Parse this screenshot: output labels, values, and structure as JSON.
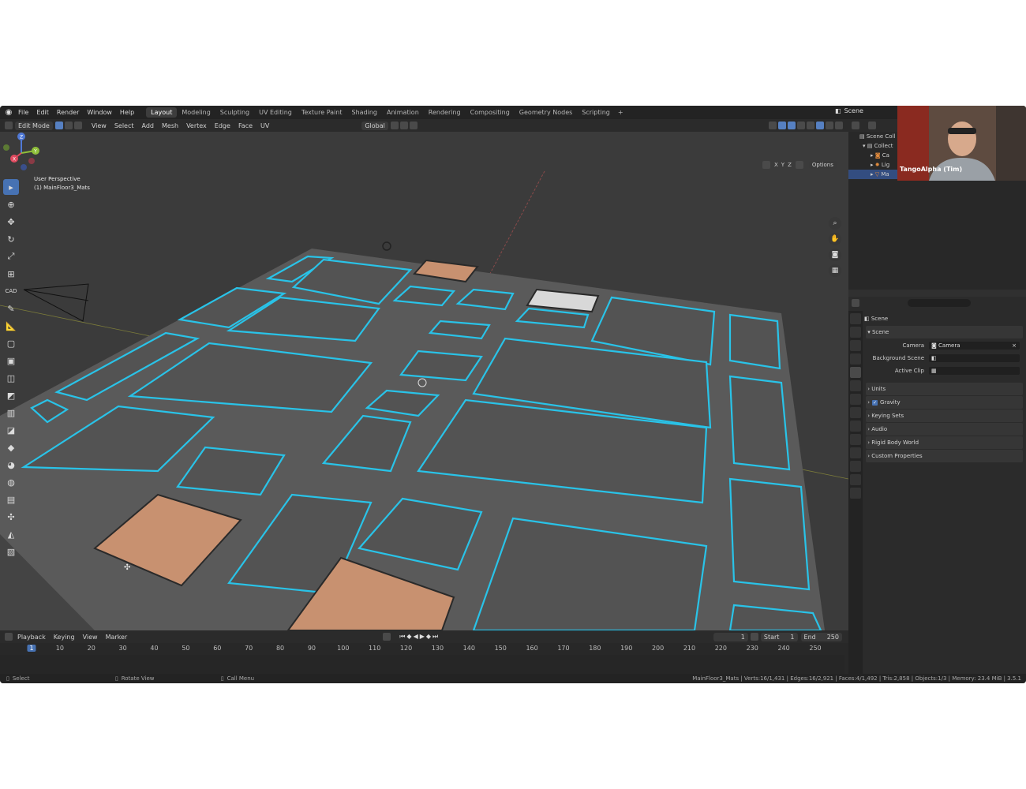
{
  "menubar": {
    "items": [
      "File",
      "Edit",
      "Render",
      "Window",
      "Help"
    ],
    "workspaces": [
      "Layout",
      "Modeling",
      "Sculpting",
      "UV Editing",
      "Texture Paint",
      "Shading",
      "Animation",
      "Rendering",
      "Compositing",
      "Geometry Nodes",
      "Scripting"
    ],
    "active_workspace": "Layout",
    "scene": "Scene"
  },
  "header": {
    "mode": "Edit Mode",
    "menus": [
      "View",
      "Select",
      "Add",
      "Mesh",
      "Vertex",
      "Edge",
      "Face",
      "UV"
    ],
    "orientation": "Global",
    "options": "Options",
    "axes": [
      "X",
      "Y",
      "Z"
    ]
  },
  "viewport": {
    "view_name": "User Perspective",
    "object_name": "(1) MainFloor3_Mats",
    "gizmo_axes": {
      "z": "Z",
      "x": "X",
      "y": "Y"
    }
  },
  "toolbar": {
    "cad_label": "CAD"
  },
  "timeline": {
    "menus": [
      "Playback",
      "Keying",
      "View",
      "Marker"
    ],
    "current_frame": "1",
    "start_label": "Start",
    "start_value": "1",
    "end_label": "End",
    "end_value": "250",
    "ticks": [
      "1",
      "10",
      "20",
      "30",
      "40",
      "50",
      "60",
      "70",
      "80",
      "90",
      "100",
      "110",
      "120",
      "130",
      "140",
      "150",
      "160",
      "170",
      "180",
      "190",
      "200",
      "210",
      "220",
      "230",
      "240",
      "250"
    ]
  },
  "statusbar": {
    "select": "Select",
    "rotate": "Rotate View",
    "call_menu": "Call Menu",
    "stats": "MainFloor3_Mats | Verts:16/1,431 | Edges:16/2,921 | Faces:4/1,492 | Tris:2,858 | Objects:1/3 | Memory: 23.4 MiB | 3.5.1"
  },
  "outliner": {
    "rows": [
      "Scene Coll",
      "Collect",
      "Ca",
      "Lig",
      "Ma"
    ]
  },
  "webcam": {
    "name": "TangoAlpha (Tim)"
  },
  "properties": {
    "title": "Scene",
    "section": "Scene",
    "camera_label": "Camera",
    "camera_value": "Camera",
    "background_label": "Background Scene",
    "clip_label": "Active Clip",
    "panels": [
      "Units",
      "Gravity",
      "Keying Sets",
      "Audio",
      "Rigid Body World",
      "Custom Properties"
    ]
  },
  "colors": {
    "accent": "#4772b3",
    "edge_highlight": "#29c3e8",
    "selected_face": "#c89170"
  }
}
